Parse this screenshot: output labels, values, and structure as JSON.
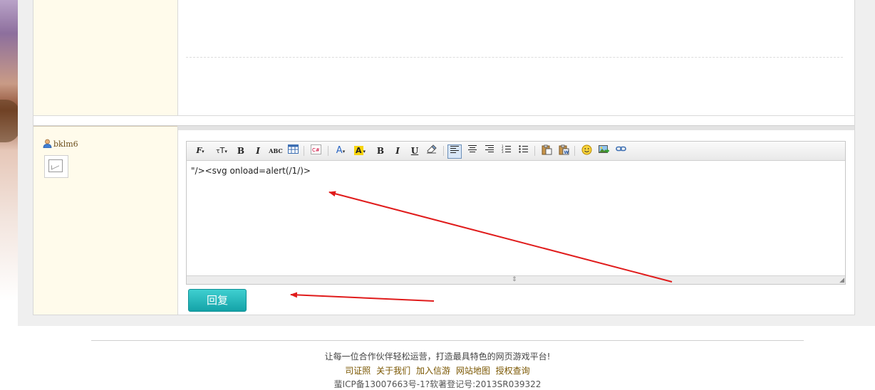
{
  "post": {
    "username": "bklm6"
  },
  "editor": {
    "content": "\"/><svg onload=alert(/1/)>",
    "toolbar": {
      "font_family": "F",
      "font_size": "TT",
      "bold": "B",
      "italic": "I",
      "abc": "ABC",
      "font_color": "A",
      "highlight": "A",
      "bold2": "B",
      "italic2": "I",
      "underline": "U"
    }
  },
  "reply_button": "回复",
  "footer": {
    "slogan": "让每一位合作伙伴轻松运营，打造最具特色的网页游戏平台!",
    "links": [
      "司证照",
      "关于我们",
      "加入信游",
      "网站地图",
      "授权查询"
    ],
    "icp": "蜚ICP备13007663号-1?软著登记号:2013SR039322"
  },
  "colors": {
    "accent": "#1aa9ae",
    "arrow": "#e01b1b",
    "sidebar_bg": "#fffbeb"
  }
}
